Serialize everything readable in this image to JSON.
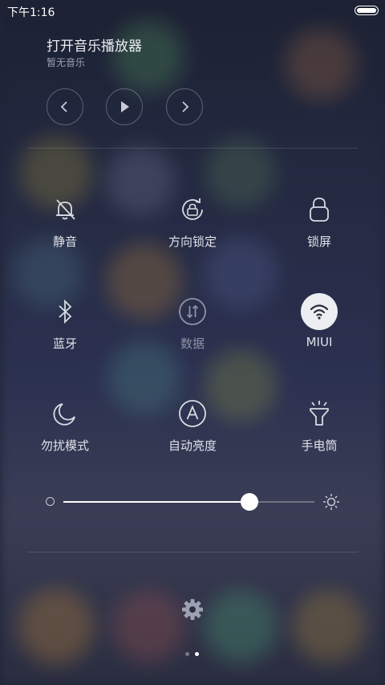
{
  "status_bar": {
    "time": "下午1:16"
  },
  "music": {
    "title": "打开音乐播放器",
    "subtitle": "暂无音乐",
    "controls": [
      "previous-icon",
      "play-icon",
      "next-icon"
    ]
  },
  "toggles": [
    {
      "label": "静音",
      "icon": "bell-mute-icon",
      "state": "off"
    },
    {
      "label": "方向锁定",
      "icon": "rotation-lock-icon",
      "state": "off"
    },
    {
      "label": "锁屏",
      "icon": "lock-icon",
      "state": "off"
    },
    {
      "label": "蓝牙",
      "icon": "bluetooth-icon",
      "state": "off"
    },
    {
      "label": "数据",
      "icon": "mobile-data-icon",
      "state": "disabled"
    },
    {
      "label": "MIUI",
      "icon": "wifi-icon",
      "state": "on"
    },
    {
      "label": "勿扰模式",
      "icon": "moon-icon",
      "state": "off"
    },
    {
      "label": "自动亮度",
      "icon": "auto-brightness-icon",
      "state": "off"
    },
    {
      "label": "手电筒",
      "icon": "flashlight-icon",
      "state": "off"
    }
  ],
  "brightness": {
    "level_fraction": 0.74
  },
  "pager": {
    "pages": 2,
    "current": 2
  },
  "colors": {
    "active_toggle": "#eceef2",
    "text": "#dfe2ea",
    "dim_text": "#8e93a4"
  }
}
